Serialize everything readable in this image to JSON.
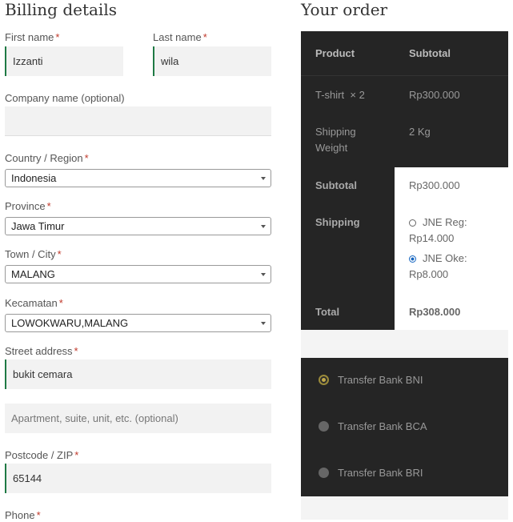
{
  "billing": {
    "title": "Billing details",
    "first_name": {
      "label": "First name",
      "value": "Izzanti"
    },
    "last_name": {
      "label": "Last name",
      "value": "wila"
    },
    "company": {
      "label": "Company name (optional)",
      "value": ""
    },
    "country": {
      "label": "Country / Region",
      "value": "Indonesia"
    },
    "province": {
      "label": "Province",
      "value": "Jawa Timur"
    },
    "town": {
      "label": "Town / City",
      "value": "MALANG"
    },
    "kecamatan": {
      "label": "Kecamatan",
      "value": "LOWOKWARU,MALANG"
    },
    "street": {
      "label": "Street address",
      "value": "bukit cemara",
      "placeholder2": "Apartment, suite, unit, etc. (optional)"
    },
    "postcode": {
      "label": "Postcode / ZIP",
      "value": "65144"
    },
    "phone": {
      "label": "Phone"
    },
    "required_mark": "*"
  },
  "order": {
    "title": "Your order",
    "col_product": "Product",
    "col_subtotal": "Subtotal",
    "item_name": "T-shirt",
    "item_qty": "× 2",
    "item_subtotal": "Rp300.000",
    "weight_label": "Shipping Weight",
    "weight_value": "2 Kg",
    "subtotal_label": "Subtotal",
    "subtotal_value": "Rp300.000",
    "shipping_label": "Shipping",
    "shipping_options": [
      {
        "label": "JNE Reg:",
        "price": "Rp14.000",
        "selected": false
      },
      {
        "label": "JNE Oke:",
        "price": "Rp8.000",
        "selected": true
      }
    ],
    "total_label": "Total",
    "total_value": "Rp308.000"
  },
  "payment": {
    "methods": [
      {
        "label": "Transfer Bank BNI",
        "selected": true
      },
      {
        "label": "Transfer Bank BCA",
        "selected": false
      },
      {
        "label": "Transfer Bank BRI",
        "selected": false
      }
    ]
  }
}
